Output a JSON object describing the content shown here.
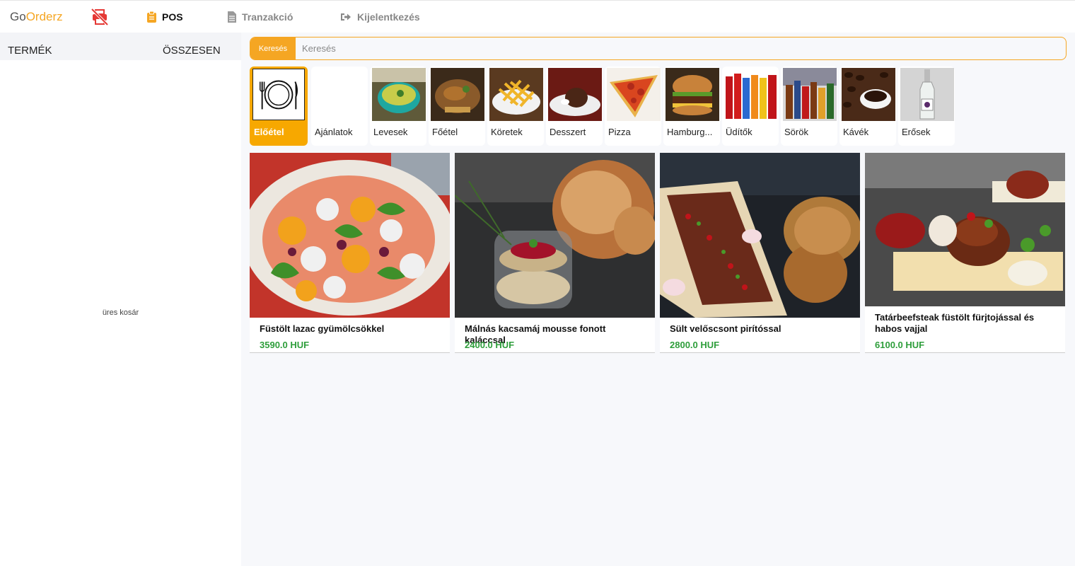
{
  "brand": {
    "part1": "Go",
    "part2": "Orderz"
  },
  "nav": {
    "pos": "POS",
    "tranzakcio": "Tranzakció",
    "logout": "Kijelentkezés"
  },
  "cart": {
    "col_product": "TERMÉK",
    "col_total": "ÖSSZESEN",
    "empty": "üres kosár"
  },
  "search": {
    "button": "Keresés",
    "placeholder": "Keresés"
  },
  "categories": [
    {
      "label": "Előétel",
      "active": true
    },
    {
      "label": "Ajánlatok"
    },
    {
      "label": "Levesek"
    },
    {
      "label": "Főétel"
    },
    {
      "label": "Köretek"
    },
    {
      "label": "Desszert"
    },
    {
      "label": "Pizza"
    },
    {
      "label": "Hamburg..."
    },
    {
      "label": "Üdítők"
    },
    {
      "label": "Sörök"
    },
    {
      "label": "Kávék"
    },
    {
      "label": "Erősek"
    }
  ],
  "products": [
    {
      "name": "Füstölt lazac gyümölcsökkel",
      "price": "3590.0 HUF"
    },
    {
      "name": "Málnás kacsamáj mousse fonott kaláccsal",
      "price": "2400.0 HUF"
    },
    {
      "name": "Sült velőscsont pirítóssal",
      "price": "2800.0 HUF"
    },
    {
      "name": "Tatárbeefsteak füstölt fürjtojással és habos vajjal",
      "price": "6100.0 HUF"
    }
  ],
  "colors": {
    "accent": "#f5a623",
    "price": "#2e9e3b",
    "alert": "#e53935"
  }
}
